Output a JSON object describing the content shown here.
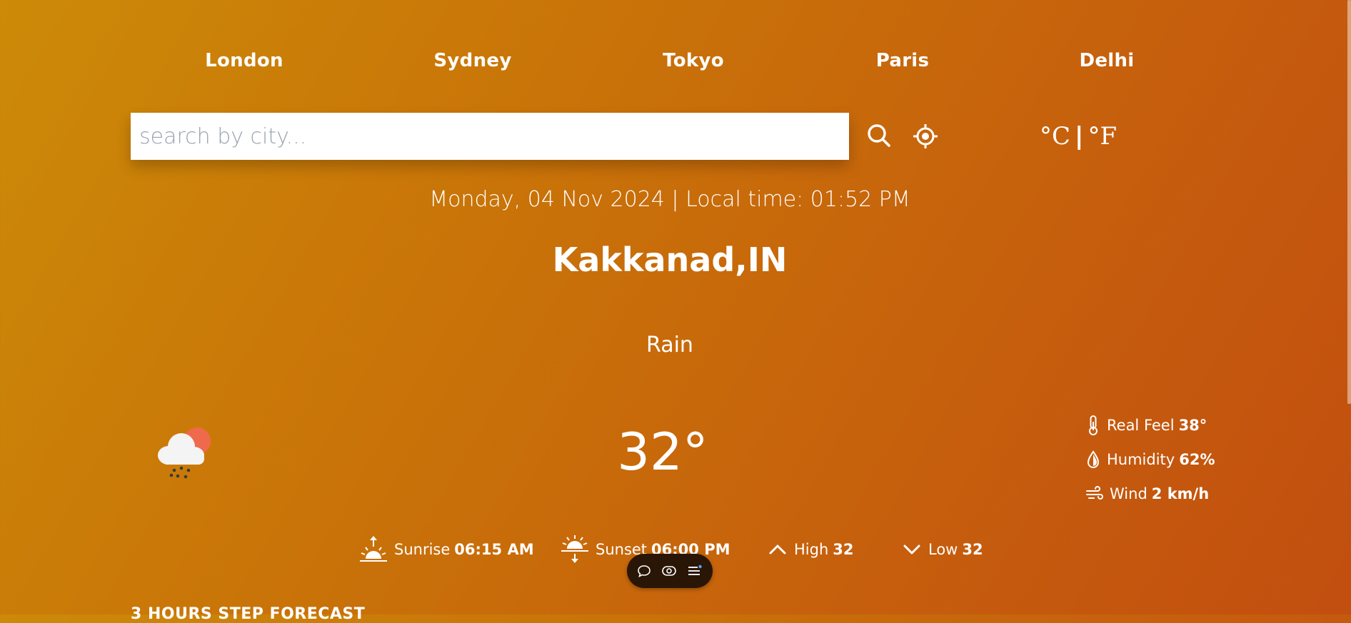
{
  "cities": [
    {
      "label": "London"
    },
    {
      "label": "Sydney"
    },
    {
      "label": "Tokyo"
    },
    {
      "label": "Paris"
    },
    {
      "label": "Delhi"
    }
  ],
  "search": {
    "placeholder": "search by city...",
    "value": ""
  },
  "icons": {
    "search": "search-icon",
    "location": "crosshair-location-icon",
    "weather": "rain-cloud-sun-icon",
    "real_feel": "thermometer-icon",
    "humidity": "droplet-icon",
    "wind": "wind-icon",
    "sunrise": "sunrise-icon",
    "sunset": "sunset-icon",
    "high": "chevron-up-icon",
    "low": "chevron-down-icon"
  },
  "units": {
    "celsius": "°C",
    "separator": "|",
    "fahrenheit": "°F"
  },
  "datetime": "Monday, 04 Nov 2024 | Local time: 01:52 PM",
  "location": "Kakkanad,IN",
  "condition": "Rain",
  "temperature": "32°",
  "details": {
    "real_feel": {
      "label": "Real Feel",
      "value": "38°"
    },
    "humidity": {
      "label": "Humidity",
      "value": "62%"
    },
    "wind": {
      "label": "Wind",
      "value": "2 km/h"
    }
  },
  "sun": {
    "sunrise": {
      "label": "Sunrise",
      "value": "06:15 AM"
    },
    "sunset": {
      "label": "Sunset",
      "value": "06:00 PM"
    },
    "high": {
      "label": "High",
      "value": "32"
    },
    "low": {
      "label": "Low",
      "value": "32"
    }
  },
  "forecast_heading": "3 HOURS STEP FORECAST",
  "colors": {
    "background_start": "#cc8a08",
    "background_end": "#c24e0f",
    "text": "#ffffff",
    "toolbar": "#2a1606"
  }
}
